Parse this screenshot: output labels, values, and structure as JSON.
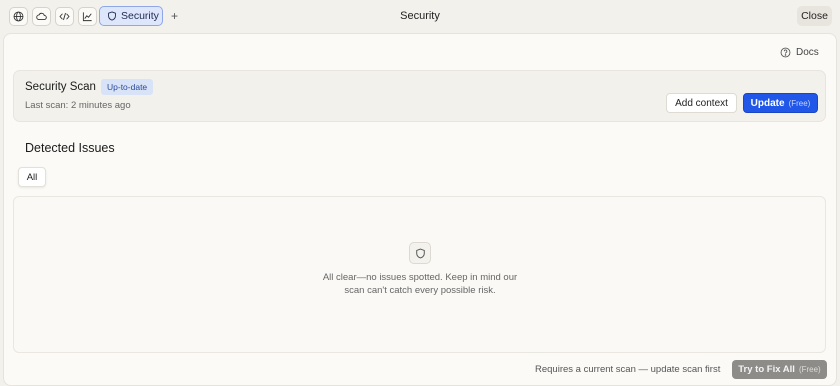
{
  "topbar": {
    "icons": [
      "globe-icon",
      "cloud-icon",
      "code-icon",
      "chart-icon"
    ],
    "active_tab": {
      "label": "Security",
      "icon": "shield-icon"
    },
    "add_tab_glyph": "+",
    "title": "Security",
    "close_label": "Close"
  },
  "docs": {
    "label": "Docs",
    "icon": "help-circle-icon"
  },
  "scan": {
    "title": "Security Scan",
    "status_badge": "Up-to-date",
    "last_scan": "Last scan: 2 minutes ago",
    "add_context_label": "Add context",
    "update_label": "Update",
    "update_sub": "(Free)"
  },
  "issues": {
    "heading": "Detected Issues",
    "filter_all": "All",
    "empty_icon": "shield-icon",
    "empty_message": "All clear—no issues spotted. Keep in mind our scan can't catch every possible risk."
  },
  "footer": {
    "note": "Requires a current scan — update scan first",
    "fix_label": "Try to Fix All",
    "fix_sub": "(Free)"
  },
  "colors": {
    "accent": "#2157e8",
    "badge_bg": "#d9e3f8",
    "disabled_button": "#8d8c89",
    "background": "#f3f1ec"
  }
}
